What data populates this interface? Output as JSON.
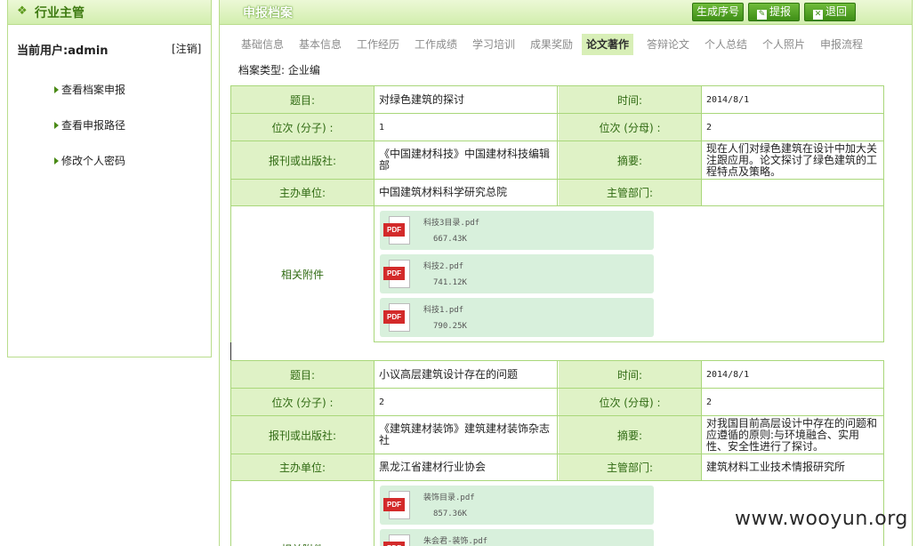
{
  "left_panel": {
    "title": "行业主管",
    "current_user": "当前用户:admin",
    "logout": "[注销]",
    "nav": [
      "查看档案申报",
      "查看申报路径",
      "修改个人密码"
    ]
  },
  "header": {
    "title": "申报档案",
    "buttons": {
      "generate": "生成序号",
      "submit": "提报",
      "back": "退回"
    }
  },
  "tabs": [
    "基础信息",
    "基本信息",
    "工作经历",
    "工作成绩",
    "学习培训",
    "成果奖励",
    "论文著作",
    "答辩论文",
    "个人总结",
    "个人照片",
    "申报流程"
  ],
  "active_tab": "论文著作",
  "archive_type": "档案类型: 企业编",
  "labels": {
    "title": "题目:",
    "time": "时间:",
    "rank_num": "位次 (分子) :",
    "rank_den": "位次 (分母) :",
    "publisher": "报刊或出版社:",
    "abstract": "摘要:",
    "host": "主办单位:",
    "dept": "主管部门:",
    "attachments": "相关附件"
  },
  "records": [
    {
      "title": "对绿色建筑的探讨",
      "time": "2014/8/1",
      "rank_num": "1",
      "rank_den": "2",
      "publisher": "《中国建材科技》中国建材科技编辑部",
      "abstract": "现在人们对绿色建筑在设计中加大关注跟应用。论文探讨了绿色建筑的工程特点及策略。",
      "host": "中国建筑材料科学研究总院",
      "dept": "",
      "files": [
        {
          "name": "科技3目录.pdf",
          "size": "667.43K"
        },
        {
          "name": "科技2.pdf",
          "size": "741.12K"
        },
        {
          "name": "科技1.pdf",
          "size": "790.25K"
        }
      ]
    },
    {
      "title": "小议高层建筑设计存在的问题",
      "time": "2014/8/1",
      "rank_num": "2",
      "rank_den": "2",
      "publisher": "《建筑建材装饰》建筑建材装饰杂志社",
      "abstract": "对我国目前高层设计中存在的问题和应遵循的原则:与环境融合、实用性、安全性进行了探讨。",
      "host": "黑龙江省建材行业协会",
      "dept": "建筑材料工业技术情报研究所",
      "files": [
        {
          "name": "装饰目录.pdf",
          "size": "857.36K"
        },
        {
          "name": "朱会君-装饰.pdf",
          "size": ""
        }
      ]
    }
  ],
  "watermark": "www.wooyun.org"
}
